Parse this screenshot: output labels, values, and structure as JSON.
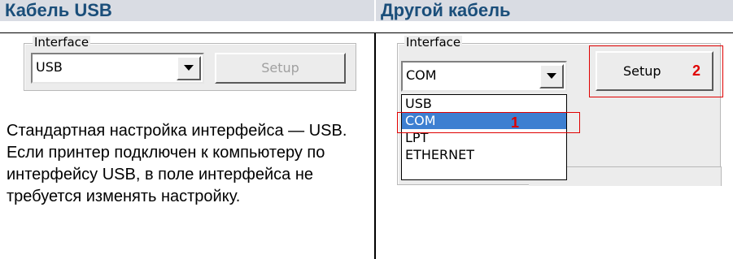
{
  "left": {
    "heading": "Кабель USB",
    "interface_label": "Interface",
    "interface_value": "USB",
    "setup_label": "Setup",
    "description": "Стандартная настройка интерфейса — USB. Если принтер подключен к компьютеру по интерфейсу USB, в поле интерфейса не требуется изменять настройку."
  },
  "right": {
    "heading": "Другой кабель",
    "interface_label": "Interface",
    "interface_value": "COM",
    "setup_label": "Setup",
    "options": [
      "USB",
      "COM",
      "LPT",
      "ETHERNET"
    ],
    "selected_option": "COM",
    "marker_1": "1",
    "marker_2": "2"
  },
  "colors": {
    "heading_bg": "#d9dce3",
    "heading_text": "#1a4e7a",
    "selection": "#3d7fd1",
    "marker": "#e00000"
  }
}
